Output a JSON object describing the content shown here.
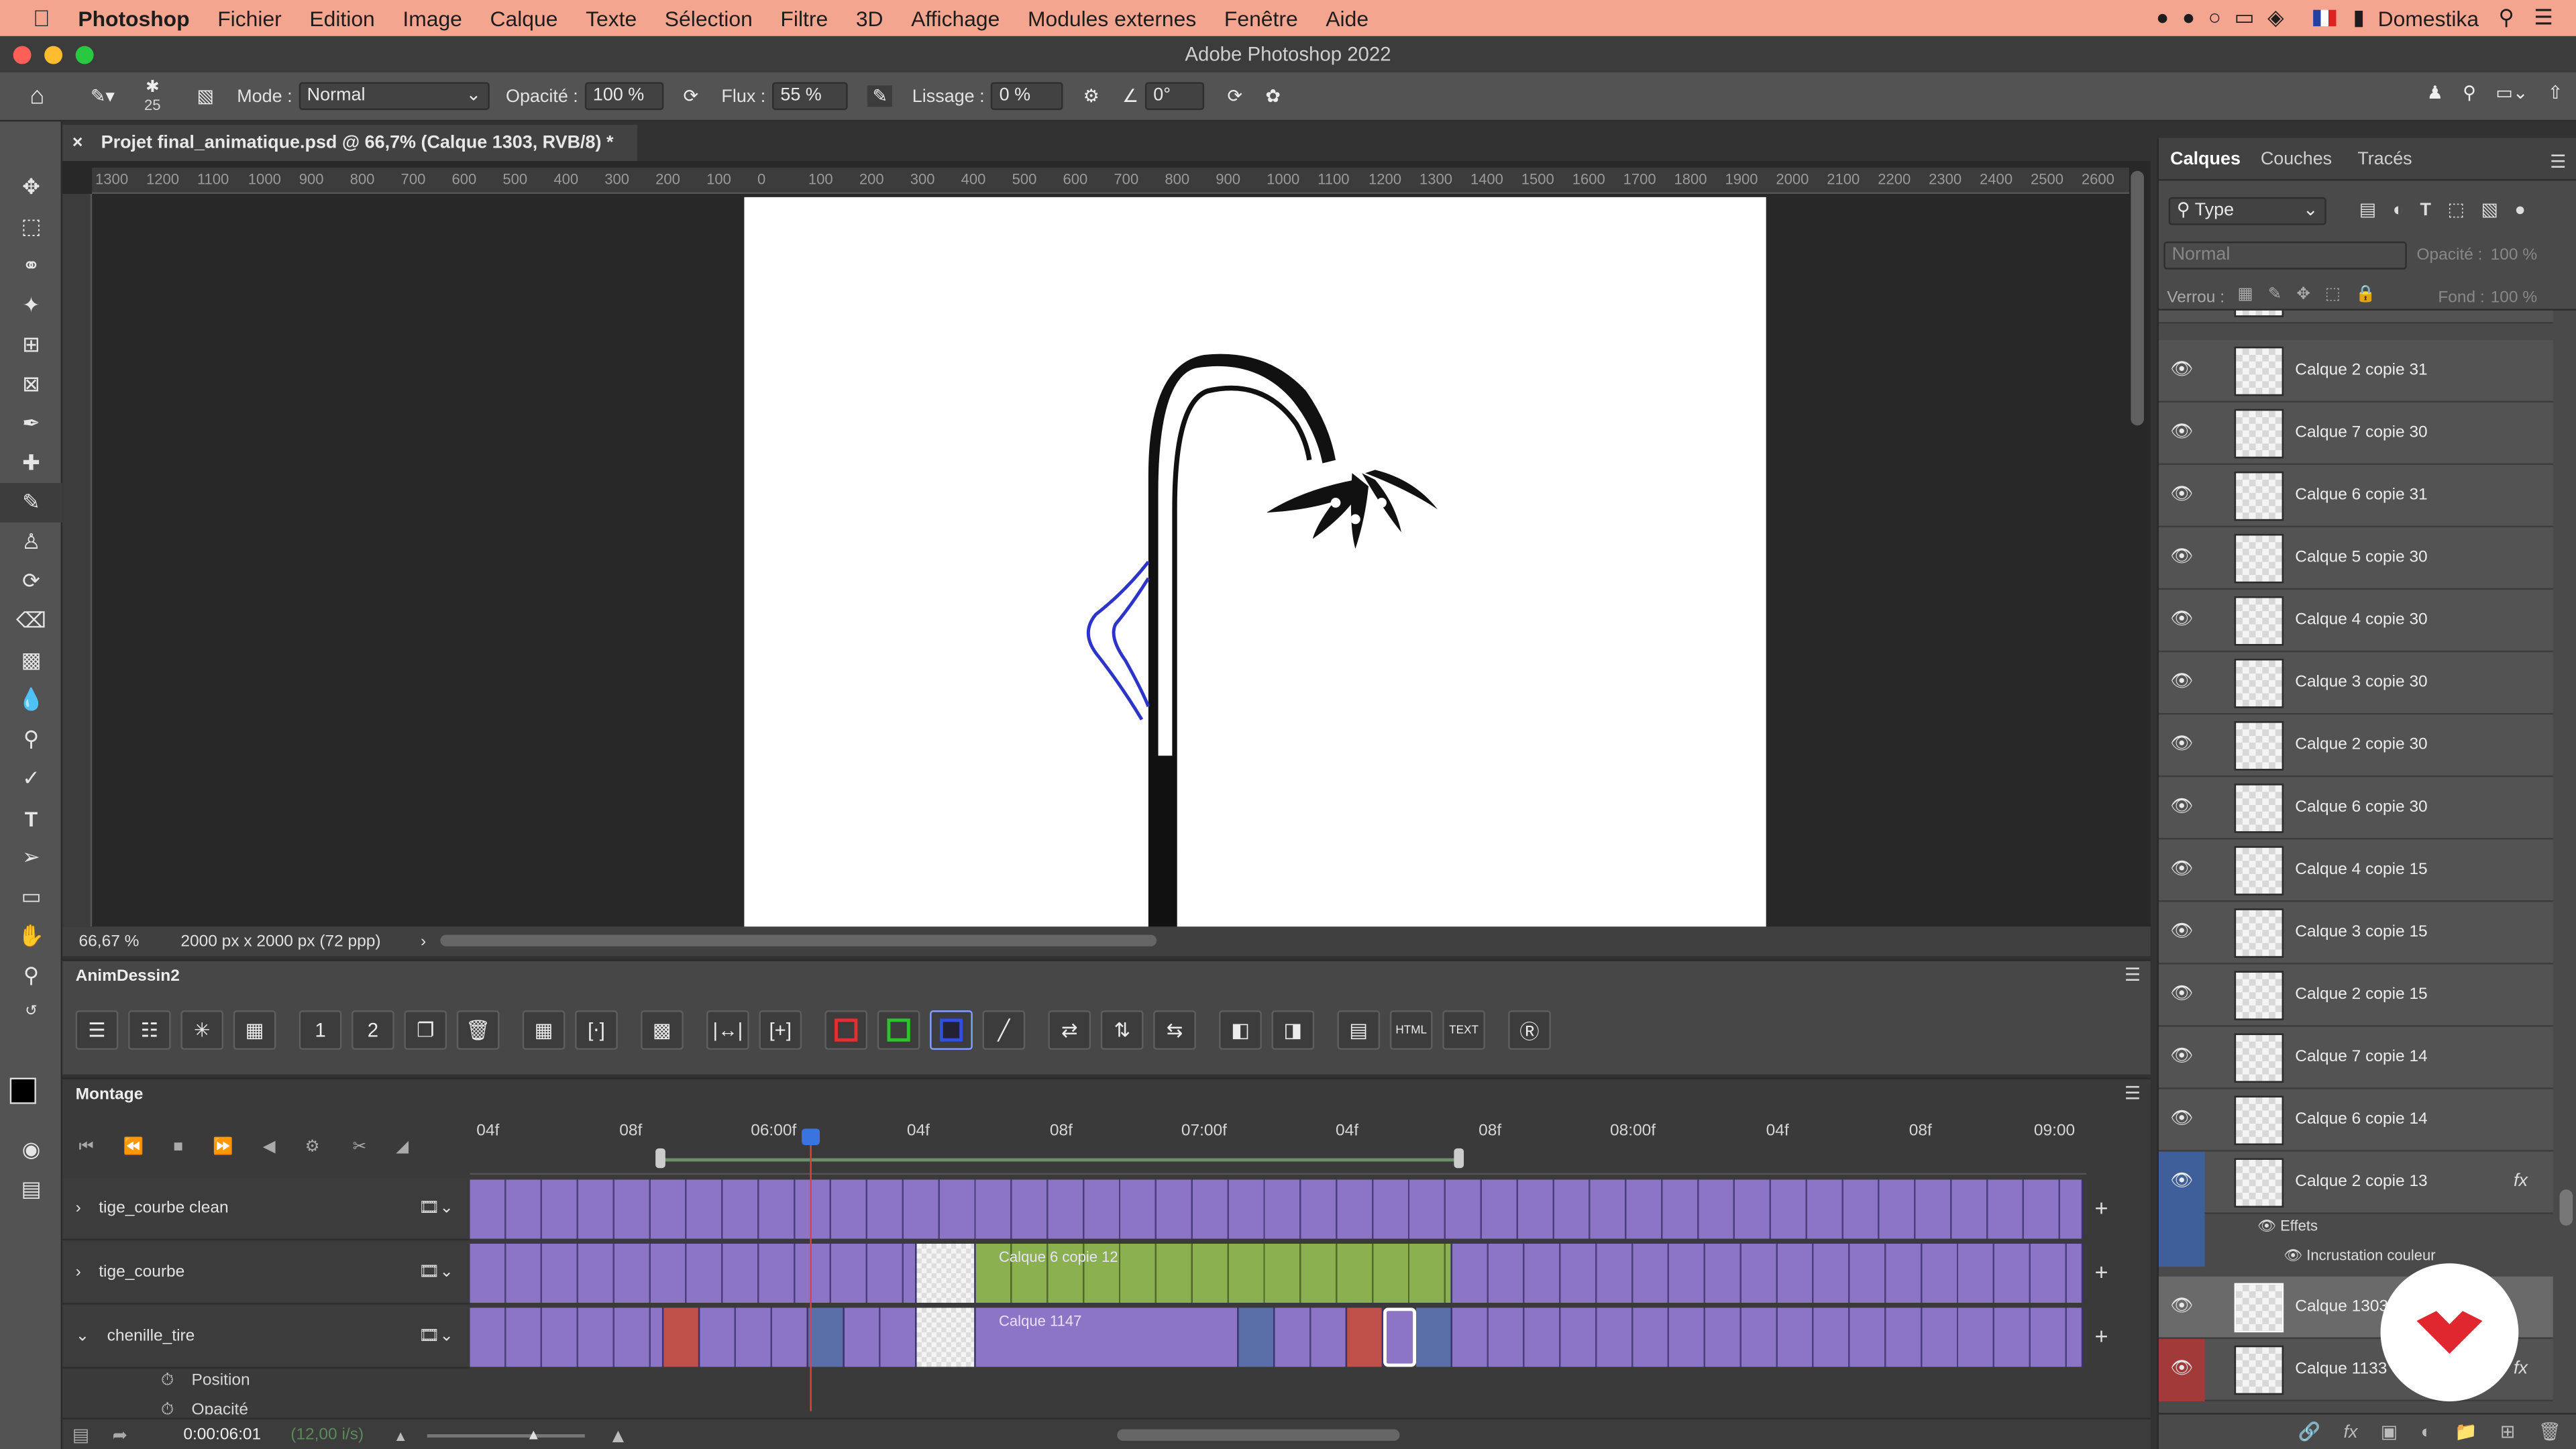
{
  "menubar": {
    "apple_icon": "apple-icon",
    "app_name": "Photoshop",
    "items": [
      "Fichier",
      "Edition",
      "Image",
      "Calque",
      "Texte",
      "Sélection",
      "Filtre",
      "3D",
      "Affichage",
      "Modules externes",
      "Fenêtre",
      "Aide"
    ],
    "right_user": "Domestika"
  },
  "window": {
    "title": "Adobe Photoshop 2022"
  },
  "options": {
    "brush_size": "25",
    "mode_label": "Mode :",
    "mode_value": "Normal",
    "opacity_label": "Opacité :",
    "opacity_value": "100 %",
    "flux_label": "Flux :",
    "flux_value": "55 %",
    "lissage_label": "Lissage :",
    "lissage_value": "0 %",
    "angle_value": "0°"
  },
  "document": {
    "tab_title": "Projet final_animatique.psd @ 66,7% (Calque 1303, RVB/8) *",
    "zoom": "66,67 %",
    "doc_info": "2000 px x 2000 px (72 ppp)",
    "ruler_labels": [
      "1300",
      "1200",
      "1100",
      "1000",
      "900",
      "800",
      "700",
      "600",
      "500",
      "400",
      "300",
      "200",
      "100",
      "0",
      "100",
      "200",
      "300",
      "400",
      "500",
      "600",
      "700",
      "800",
      "900",
      "1000",
      "1100",
      "1200",
      "1300",
      "1400",
      "1500",
      "1600",
      "1700",
      "1800",
      "1900",
      "2000",
      "2100",
      "2200",
      "2300",
      "2400",
      "2500",
      "2600"
    ]
  },
  "anim_panel": {
    "title": "AnimDessin2"
  },
  "timeline": {
    "title": "Montage",
    "time_labels": [
      "04f",
      "08f",
      "06:00f",
      "04f",
      "08f",
      "07:00f",
      "04f",
      "08f",
      "08:00f",
      "04f",
      "08f",
      "09:00"
    ],
    "current_time": "0:00:06:01",
    "fps": "(12,00 i/s)",
    "tracks": [
      {
        "name": "tige_courbe clean"
      },
      {
        "name": "tige_courbe",
        "clip_label": "Calque 6 copie 12"
      },
      {
        "name": "chenille_tire",
        "clip_label": "Calque 1147"
      }
    ],
    "sub_rows": [
      "Position",
      "Opacité"
    ]
  },
  "layers_panel": {
    "tabs": [
      "Calques",
      "Couches",
      "Tracés"
    ],
    "filter": "Type",
    "blend": "Normal",
    "opacity_label": "Opacité :",
    "opacity_value": "100 %",
    "lock_label": "Verrou :",
    "fill_label": "Fond :",
    "fill_value": "100 %",
    "layers": [
      "Calque 2 copie 31",
      "Calque 7 copie 30",
      "Calque 6 copie 31",
      "Calque 5 copie 30",
      "Calque 4 copie 30",
      "Calque 3 copie 30",
      "Calque 2 copie 30",
      "Calque 6 copie 30",
      "Calque 4 copie 15",
      "Calque 3 copie 15",
      "Calque 2 copie 15",
      "Calque 7 copie 14",
      "Calque 6 copie 14",
      "Calque 2 copie 13"
    ],
    "effects_label": "Effets",
    "effect_item": "Incrustation couleur",
    "selected_layer": "Calque 1303",
    "last_layer": "Calque 1133"
  },
  "colors": {
    "accent": "#2d5fd6",
    "menubar": "#f4a58f",
    "frame_purple": "#8c75c6",
    "frame_green": "#8ab04f",
    "logo_red": "#e0262e"
  }
}
